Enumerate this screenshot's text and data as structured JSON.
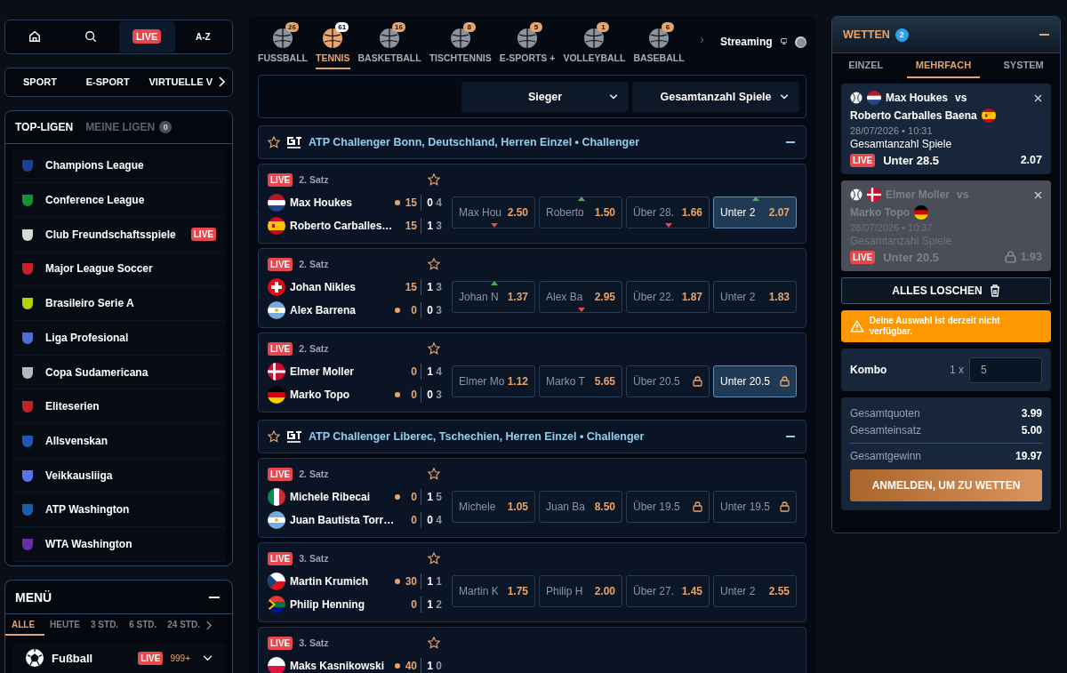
{
  "nav": {
    "items": [
      {
        "kind": "home",
        "selected": false
      },
      {
        "kind": "search",
        "selected": false
      },
      {
        "kind": "live",
        "label": "LIVE",
        "selected": true
      },
      {
        "kind": "text",
        "label": "A-Z",
        "selected": false
      }
    ]
  },
  "sport_types": {
    "items": [
      {
        "label": "SPORT"
      },
      {
        "label": "E-SPORT"
      },
      {
        "label": "VIRTUELLE V"
      }
    ]
  },
  "leagues": {
    "tabs": [
      {
        "label": "TOP-LIGEN",
        "selected": true
      },
      {
        "label": "MEINE LIGEN",
        "count": "0",
        "selected": false
      }
    ],
    "items": [
      {
        "name": "Champions League",
        "color": "#1c3f94"
      },
      {
        "name": "Conference League",
        "color": "#14923a"
      },
      {
        "name": "Club Freundschaftsspiele",
        "color": "#d8d8d8",
        "badge": "LIVE"
      },
      {
        "name": "Major League Soccer",
        "color": "#c8202f"
      },
      {
        "name": "Brasileiro Serie A",
        "color": "#b5d000"
      },
      {
        "name": "Liga Profesional",
        "color": "#4a6fd0"
      },
      {
        "name": "Copa Sudamericana",
        "color": "#b8b8b8"
      },
      {
        "name": "Eliteserien",
        "color": "#c0232c"
      },
      {
        "name": "Allsvenskan",
        "color": "#2456b0"
      },
      {
        "name": "Veikkausliiga",
        "color": "#5b6ff0"
      },
      {
        "name": "ATP Washington",
        "color": "#1b5fa8"
      },
      {
        "name": "WTA Washington",
        "color": "#6a2fa8"
      }
    ]
  },
  "menu": {
    "title": "MENÜ",
    "time_tabs": [
      {
        "label": "ALLE",
        "selected": true
      },
      {
        "label": "HEUTE",
        "selected": false
      },
      {
        "label": "3 STD.",
        "selected": false
      },
      {
        "label": "6 STD.",
        "selected": false
      },
      {
        "label": "24 STD.",
        "selected": false
      }
    ],
    "sports": [
      {
        "name": "Fußball",
        "badge": "LIVE",
        "count": "999+"
      }
    ]
  },
  "sports_bar": {
    "tabs": [
      {
        "label": "FUSSBALL",
        "count": "26",
        "selected": false
      },
      {
        "label": "TENNIS",
        "count": "61",
        "selected": true
      },
      {
        "label": "BASKETBALL",
        "count": "16",
        "selected": false
      },
      {
        "label": "TISCHTENNIS",
        "count": "8",
        "selected": false
      },
      {
        "label": "E-SPORTS +",
        "count": "5",
        "selected": false
      },
      {
        "label": "VOLLEYBALL",
        "count": "1",
        "selected": false
      },
      {
        "label": "BASEBALL",
        "count": "6",
        "selected": false
      }
    ],
    "streaming": {
      "label": "Streaming",
      "on": false
    }
  },
  "filters": [
    "Sieger",
    "Gesamtanzahl Spiele"
  ],
  "tournaments": [
    {
      "title": "ATP Challenger Bonn, Deutschland, Herren Einzel • Challenger",
      "matches": [
        {
          "badge": "LIVE",
          "period": "2. Satz",
          "players": [
            {
              "name": "Max Houkes",
              "flag": {
                "kind": "nl"
              },
              "serving": true,
              "points": "15",
              "sets": "0",
              "games": "4"
            },
            {
              "name": "Roberto Carballes…",
              "flag": {
                "kind": "es"
              },
              "serving": false,
              "points": "15",
              "sets": "1",
              "games": "3"
            }
          ],
          "odds": [
            {
              "label": "Max Hou",
              "value": "2.50",
              "up": false,
              "down": true,
              "locked": false,
              "selected": false
            },
            {
              "label": "Roberto",
              "value": "1.50",
              "up": true,
              "down": false,
              "locked": false,
              "selected": false
            },
            {
              "label": "Über 28.",
              "value": "1.66",
              "up": false,
              "down": true,
              "locked": false,
              "selected": false
            },
            {
              "label": "Unter 2",
              "value": "2.07",
              "up": true,
              "down": false,
              "locked": false,
              "selected": true
            }
          ]
        },
        {
          "badge": "LIVE",
          "period": "2. Satz",
          "players": [
            {
              "name": "Johan Nikles",
              "flag": {
                "kind": "ch"
              },
              "serving": false,
              "points": "15",
              "sets": "1",
              "games": "3"
            },
            {
              "name": "Alex Barrena",
              "flag": {
                "kind": "ar"
              },
              "serving": true,
              "points": "0",
              "sets": "0",
              "games": "3"
            }
          ],
          "odds": [
            {
              "label": "Johan N",
              "value": "1.37",
              "up": true,
              "down": false,
              "locked": false,
              "selected": false
            },
            {
              "label": "Alex Ba",
              "value": "2.95",
              "up": false,
              "down": true,
              "locked": false,
              "selected": false
            },
            {
              "label": "Über 22.",
              "value": "1.87",
              "up": false,
              "down": false,
              "locked": false,
              "selected": false
            },
            {
              "label": "Unter 2",
              "value": "1.83",
              "up": false,
              "down": false,
              "locked": false,
              "selected": false
            }
          ]
        },
        {
          "badge": "LIVE",
          "period": "2. Satz",
          "players": [
            {
              "name": "Elmer Moller",
              "flag": {
                "kind": "dk"
              },
              "serving": false,
              "points": "0",
              "sets": "1",
              "games": "4"
            },
            {
              "name": "Marko Topo",
              "flag": {
                "kind": "de"
              },
              "serving": true,
              "points": "0",
              "sets": "0",
              "games": "3"
            }
          ],
          "odds": [
            {
              "label": "Elmer Mo",
              "value": "1.12",
              "up": false,
              "down": false,
              "locked": false,
              "selected": false
            },
            {
              "label": "Marko T",
              "value": "5.65",
              "up": false,
              "down": false,
              "locked": false,
              "selected": false
            },
            {
              "label": "Über 20.5",
              "up": false,
              "down": false,
              "locked": true,
              "selected": false
            },
            {
              "label": "Unter 20.5",
              "up": false,
              "down": false,
              "locked": true,
              "selected": true
            }
          ]
        }
      ]
    },
    {
      "title": "ATP Challenger Liberec, Tschechien, Herren Einzel • Challenger",
      "matches": [
        {
          "badge": "LIVE",
          "period": "2. Satz",
          "players": [
            {
              "name": "Michele Ribecai",
              "flag": {
                "kind": "it"
              },
              "serving": true,
              "points": "0",
              "sets": "1",
              "games": "5"
            },
            {
              "name": "Juan Bautista Torr…",
              "flag": {
                "kind": "ar"
              },
              "serving": false,
              "points": "0",
              "sets": "0",
              "games": "4"
            }
          ],
          "odds": [
            {
              "label": "Michele",
              "value": "1.05",
              "up": false,
              "down": false,
              "locked": false,
              "selected": false
            },
            {
              "label": "Juan Ba",
              "value": "8.50",
              "up": false,
              "down": false,
              "locked": false,
              "selected": false
            },
            {
              "label": "Über 19.5",
              "up": false,
              "down": false,
              "locked": true,
              "selected": false
            },
            {
              "label": "Unter 19.5",
              "up": false,
              "down": false,
              "locked": true,
              "selected": false
            }
          ]
        },
        {
          "badge": "LIVE",
          "period": "3. Satz",
          "players": [
            {
              "name": "Martin Krumich",
              "flag": {
                "kind": "cz"
              },
              "serving": true,
              "points": "30",
              "sets": "1",
              "games": "1"
            },
            {
              "name": "Philip Henning",
              "flag": {
                "kind": "za"
              },
              "serving": false,
              "points": "0",
              "sets": "1",
              "games": "2"
            }
          ],
          "odds": [
            {
              "label": "Martin K",
              "value": "1.75",
              "up": false,
              "down": false,
              "locked": false,
              "selected": false
            },
            {
              "label": "Philip H",
              "value": "2.00",
              "up": false,
              "down": false,
              "locked": false,
              "selected": false
            },
            {
              "label": "Über 27.",
              "value": "1.45",
              "up": false,
              "down": false,
              "locked": false,
              "selected": false
            },
            {
              "label": "Unter 2",
              "value": "2.55",
              "up": false,
              "down": false,
              "locked": false,
              "selected": false
            }
          ]
        },
        {
          "badge": "LIVE",
          "period": "3. Satz",
          "players": [
            {
              "name": "Maks Kasnikowski",
              "flag": {
                "kind": "pl"
              },
              "serving": true,
              "points": "40",
              "sets": "1",
              "games": "0"
            }
          ]
        }
      ]
    }
  ],
  "betslip": {
    "title": "WETTEN",
    "count": "2",
    "tabs": [
      {
        "label": "EINZEL",
        "selected": false
      },
      {
        "label": "MEHRFACH",
        "selected": true
      },
      {
        "label": "SYSTEM",
        "selected": false
      }
    ],
    "bets": [
      {
        "home": "Max Houkes",
        "home_flag": {
          "kind": "nl"
        },
        "vs": "vs",
        "away": "Roberto Carballes Baena",
        "away_flag": {
          "kind": "es"
        },
        "date": "28/07/2026 • 10:31",
        "market": "Gesamtanzahl Spiele",
        "badge": "LIVE",
        "pick": "Unter 28.5",
        "odds": "2.07",
        "disabled": false
      },
      {
        "home": "Elmer Moller",
        "home_flag": {
          "kind": "dk"
        },
        "vs": "vs",
        "away": "Marko Topo",
        "away_flag": {
          "kind": "de"
        },
        "date": "28/07/2026 • 10:37",
        "market": "Gesamtanzahl Spiele",
        "badge": "LIVE",
        "pick": "Unter 20.5",
        "odds": "1.93",
        "disabled": true
      }
    ],
    "clear_button": "ALLES LOSCHEN",
    "warning": "Deine Auswahl ist derzeit nicht verfügbar.",
    "combo": {
      "label": "Kombo",
      "multiplier": "1 x",
      "stake": "5"
    },
    "totals": [
      {
        "label": "Gesamtquoten",
        "value": "3.99",
        "separated": false
      },
      {
        "label": "Gesamteinsatz",
        "value": "5.00",
        "separated": false
      },
      {
        "label": "Gesamtgewinn",
        "value": "19.97",
        "separated": true
      }
    ],
    "submit": "ANMELDEN, UM ZU WETTEN"
  }
}
